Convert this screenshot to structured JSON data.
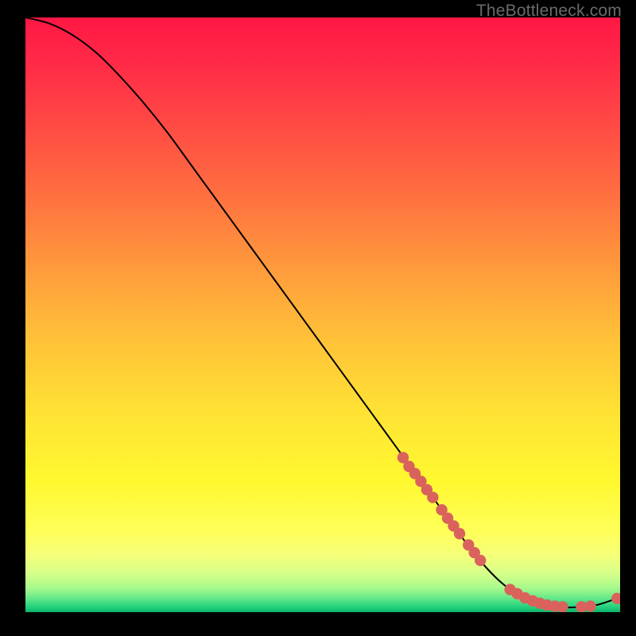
{
  "watermark": "TheBottleneck.com",
  "colors": {
    "curve": "#000000",
    "marker_fill": "#d9635c",
    "marker_stroke": "#b84d46",
    "bg_black": "#000000"
  },
  "chart_data": {
    "type": "line",
    "title": "",
    "xlabel": "",
    "ylabel": "",
    "xlim": [
      0,
      100
    ],
    "ylim": [
      0,
      100
    ],
    "grid": false,
    "curve": {
      "x": [
        0,
        4,
        8,
        12,
        16,
        20,
        24,
        28,
        32,
        36,
        40,
        44,
        48,
        52,
        56,
        60,
        64,
        68,
        72,
        76,
        80,
        84,
        88,
        92,
        96,
        100
      ],
      "y": [
        100,
        99,
        97,
        94,
        90,
        85.5,
        80.5,
        75,
        69.5,
        64,
        58.5,
        53,
        47.5,
        42,
        36.5,
        31,
        25.5,
        20,
        14.5,
        9.2,
        5.0,
        2.3,
        1.0,
        0.8,
        1.2,
        2.5
      ]
    },
    "markers": [
      {
        "x": 63.5,
        "y": 26.0
      },
      {
        "x": 64.5,
        "y": 24.5
      },
      {
        "x": 65.5,
        "y": 23.3
      },
      {
        "x": 66.5,
        "y": 22.0
      },
      {
        "x": 67.5,
        "y": 20.6
      },
      {
        "x": 68.5,
        "y": 19.3
      },
      {
        "x": 70.0,
        "y": 17.2
      },
      {
        "x": 71.0,
        "y": 15.8
      },
      {
        "x": 72.0,
        "y": 14.5
      },
      {
        "x": 73.0,
        "y": 13.2
      },
      {
        "x": 74.5,
        "y": 11.3
      },
      {
        "x": 75.5,
        "y": 10.0
      },
      {
        "x": 76.5,
        "y": 8.7
      },
      {
        "x": 81.5,
        "y": 3.8
      },
      {
        "x": 82.7,
        "y": 3.1
      },
      {
        "x": 84.0,
        "y": 2.4
      },
      {
        "x": 85.3,
        "y": 1.9
      },
      {
        "x": 86.5,
        "y": 1.5
      },
      {
        "x": 87.7,
        "y": 1.2
      },
      {
        "x": 89.0,
        "y": 1.0
      },
      {
        "x": 90.3,
        "y": 0.9
      },
      {
        "x": 93.5,
        "y": 0.9
      },
      {
        "x": 95.0,
        "y": 1.0
      },
      {
        "x": 99.5,
        "y": 2.3
      }
    ],
    "gradient_stops": [
      {
        "offset": 0.0,
        "color": "#ff1744"
      },
      {
        "offset": 0.08,
        "color": "#ff2b47"
      },
      {
        "offset": 0.18,
        "color": "#ff4a44"
      },
      {
        "offset": 0.3,
        "color": "#ff7040"
      },
      {
        "offset": 0.42,
        "color": "#ff9a3c"
      },
      {
        "offset": 0.55,
        "color": "#ffc438"
      },
      {
        "offset": 0.68,
        "color": "#ffe634"
      },
      {
        "offset": 0.78,
        "color": "#fff82f"
      },
      {
        "offset": 0.865,
        "color": "#ffff5a"
      },
      {
        "offset": 0.905,
        "color": "#f4ff7a"
      },
      {
        "offset": 0.935,
        "color": "#d6ff8a"
      },
      {
        "offset": 0.96,
        "color": "#a6f98c"
      },
      {
        "offset": 0.978,
        "color": "#5fe78a"
      },
      {
        "offset": 0.992,
        "color": "#20d07c"
      },
      {
        "offset": 1.0,
        "color": "#0fb36b"
      }
    ]
  }
}
